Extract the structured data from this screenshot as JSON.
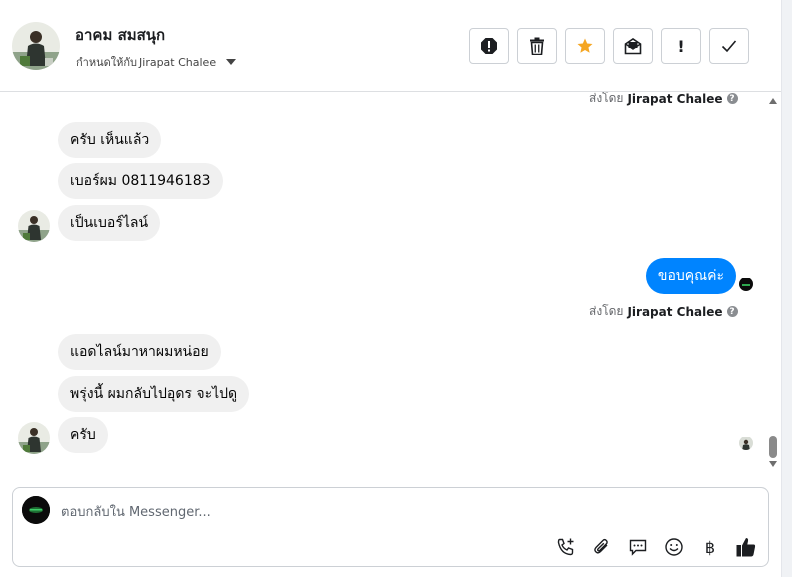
{
  "header": {
    "contact_name": "อาคม สมสนุก",
    "assign_prefix": "กำหนดให้กับ",
    "assignee": "Jirapat Chalee",
    "toolbar": [
      "spam-icon",
      "trash-icon",
      "star-icon",
      "mark-unread-icon",
      "flag-icon",
      "done-icon"
    ],
    "toolbar_flag_glyph": "!",
    "star_color": "#f5a623"
  },
  "thread": {
    "sent_by_label": "ส่งโดย",
    "sender": "Jirapat Chalee",
    "help_glyph": "?",
    "group1": [
      "ครับ เห็นแล้ว",
      "เบอร์ผม 0811946183",
      "เป็นเบอร์ไลน์"
    ],
    "outgoing": "ขอบคุณค่ะ",
    "group2": [
      "แอดไลน์มาหาผมหน่อย",
      "พรุ่งนี้ ผมกลับไปอุดร จะไปดู",
      "ครับ"
    ],
    "outgoing_color": "#0084ff"
  },
  "composer": {
    "placeholder": "ตอบกลับใน Messenger...",
    "icons": [
      "call-add-icon",
      "attach-icon",
      "saved-replies-icon",
      "emoji-icon",
      "baht-icon",
      "like-icon"
    ],
    "baht_glyph": "฿"
  }
}
